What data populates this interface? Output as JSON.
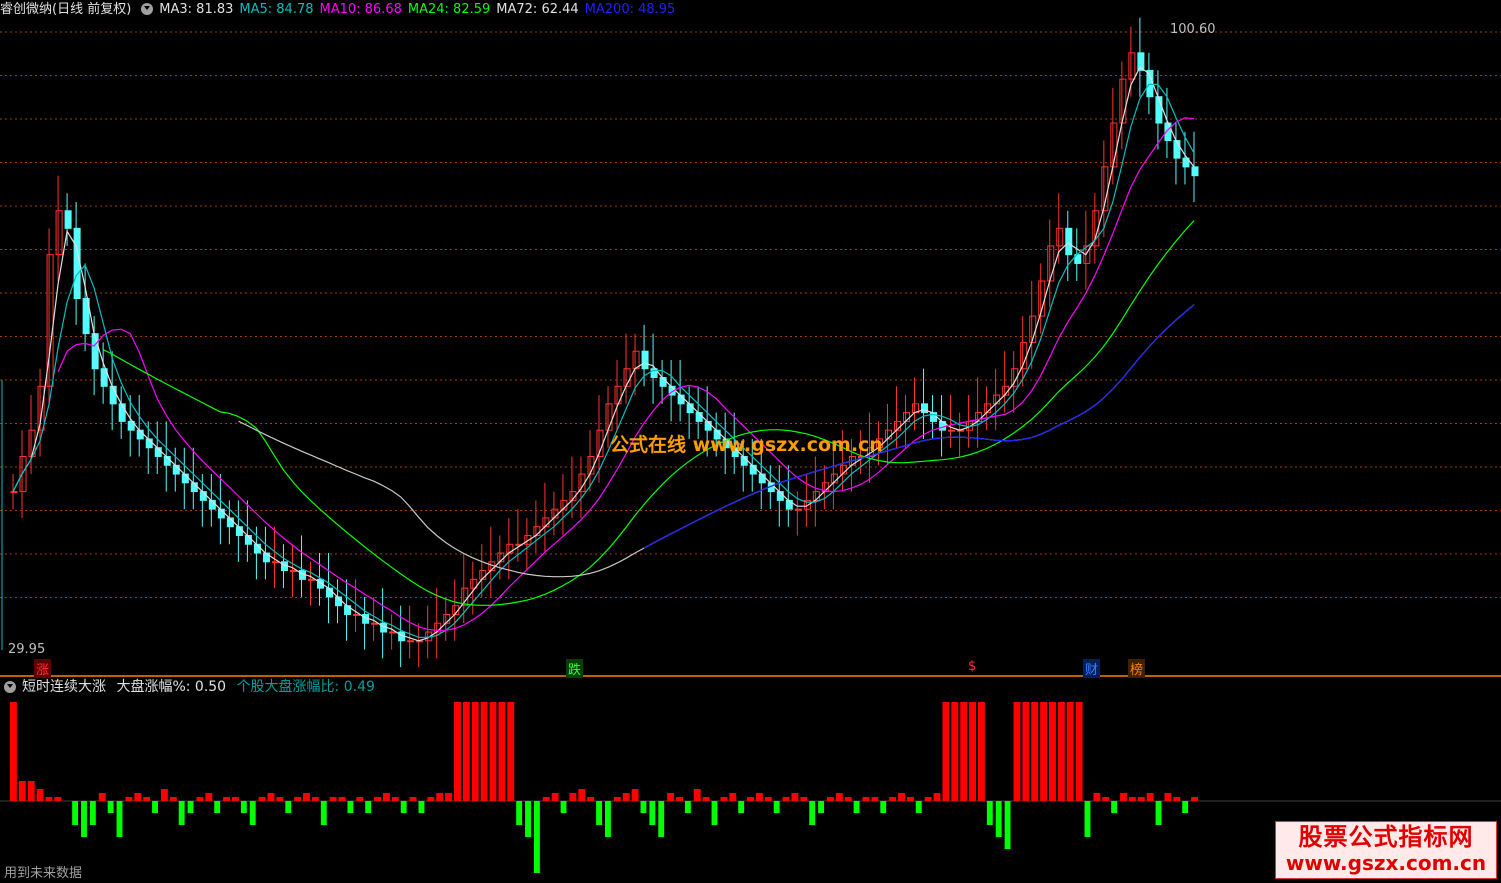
{
  "header": {
    "title": "睿创微纳(日线 前复权)",
    "ma": [
      {
        "label": "MA3: 81.83",
        "color": "#e0e0e0"
      },
      {
        "label": "MA5: 84.78",
        "color": "#00c0c0"
      },
      {
        "label": "MA10: 86.68",
        "color": "#ff00ff"
      },
      {
        "label": "MA24: 82.59",
        "color": "#00ff00"
      },
      {
        "label": "MA72: 62.44",
        "color": "#e0e0e0"
      },
      {
        "label": "MA200: 48.95",
        "color": "#0000ff"
      }
    ]
  },
  "price_axis": {
    "high_label": "100.60",
    "low_label": "29.95"
  },
  "event_tags": [
    {
      "text": "涨",
      "color": "#ff3030",
      "bg": "#600000"
    },
    {
      "text": "跌",
      "color": "#30ff30",
      "bg": "#004000"
    },
    {
      "text": "$",
      "color": "#ff3030",
      "bg": "#000000"
    },
    {
      "text": "财",
      "color": "#4080ff",
      "bg": "#002060"
    },
    {
      "text": "榜",
      "color": "#ff8000",
      "bg": "#402000"
    }
  ],
  "indicator": {
    "name": "短时连续大涨",
    "param1": "大盘涨幅%: 0.50",
    "param2": "个股大盘涨幅比: 0.49"
  },
  "watermark": "公式在线  www.gszx.com.cn",
  "footer_note": "用到未来数据",
  "logo": {
    "title": "股票公式指标网",
    "url": "www.gszx.com.cn"
  },
  "colors": {
    "up": "#ff3232",
    "down": "#54fcfc",
    "grid": "#a04000",
    "ma3": "#e0e0e0",
    "ma5": "#00c0c0",
    "ma10": "#ff00ff",
    "ma24": "#00ff00",
    "ma72": "#c8c8c8",
    "ma200": "#2020ff",
    "osc_up": "#ff0000",
    "osc_down": "#00ff00",
    "divider": "#ff8000"
  },
  "chart_data": {
    "type": "candlestick",
    "price_range": [
      29.95,
      100.6
    ],
    "closes": [
      48,
      52,
      55,
      60,
      75,
      80,
      78,
      70,
      66,
      62,
      60,
      58,
      56,
      55,
      54,
      53,
      52,
      51,
      50,
      49,
      48,
      47,
      46,
      45,
      44,
      43,
      42,
      41,
      40,
      40,
      39,
      39,
      38,
      38,
      37,
      36,
      35,
      34,
      34,
      33,
      33,
      32,
      32,
      31,
      31,
      31,
      32,
      33,
      34,
      35,
      37,
      38,
      39,
      40,
      41,
      42,
      42,
      43,
      44,
      45,
      46,
      47,
      48,
      50,
      52,
      55,
      58,
      60,
      62,
      64,
      62,
      61,
      60,
      59,
      58,
      57,
      56,
      55,
      54,
      53,
      52,
      51,
      50,
      49,
      48,
      47,
      46,
      46,
      47,
      48,
      49,
      50,
      51,
      52,
      52,
      53,
      54,
      55,
      56,
      57,
      58,
      57,
      56,
      55,
      55,
      55,
      56,
      57,
      58,
      59,
      60,
      62,
      65,
      68,
      72,
      76,
      78,
      75,
      74,
      76,
      80,
      85,
      90,
      95,
      98,
      96,
      93,
      90,
      88,
      86,
      85,
      84
    ],
    "volume_bars": [
      6,
      5,
      5,
      3,
      1,
      1,
      0,
      -2,
      -3,
      -2,
      2,
      -1,
      -3,
      1,
      2,
      1,
      -1,
      3,
      1,
      -2,
      -1,
      1,
      2,
      -1,
      1,
      1,
      -1,
      -2,
      1,
      2,
      1,
      -1,
      1,
      2,
      1,
      -2,
      1,
      1,
      -1,
      1,
      -1,
      1,
      2,
      1,
      -1,
      1,
      -1,
      1,
      2,
      2,
      6,
      6,
      6,
      6,
      6,
      6,
      6,
      -2,
      -3,
      -6,
      1,
      2,
      -1,
      2,
      3,
      1,
      -2,
      -3,
      1,
      2,
      3,
      -1,
      -2,
      -3,
      2,
      1,
      -1,
      3,
      1,
      -2,
      1,
      2,
      -1,
      1,
      2,
      1,
      -1,
      1,
      2,
      1,
      -2,
      -1,
      1,
      2,
      1,
      -1,
      1,
      1,
      -1,
      1,
      2,
      1,
      -1,
      1,
      2,
      6,
      6,
      6,
      6,
      6,
      -2,
      -3,
      -4,
      6,
      6,
      6,
      6,
      6,
      6,
      6,
      6,
      -3,
      2,
      1,
      -1,
      2,
      1,
      1,
      2,
      -2,
      2,
      1,
      -1,
      1
    ],
    "yticks": [
      100.6,
      29.95
    ]
  }
}
